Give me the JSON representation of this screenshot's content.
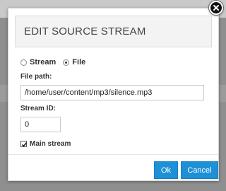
{
  "dialog": {
    "title": "EDIT SOURCE STREAM",
    "close_icon": "close-icon"
  },
  "source_type": {
    "options": [
      "Stream",
      "File"
    ],
    "selected": "File"
  },
  "file_path": {
    "label": "File path:",
    "value": "/home/user/content/mp3/silence.mp3"
  },
  "stream_id": {
    "label": "Stream ID:",
    "value": "0"
  },
  "main_stream": {
    "label": "Main stream",
    "checked": true
  },
  "buttons": {
    "ok_label": "Ok",
    "cancel_label": "Cancel"
  },
  "colors": {
    "accent": "#1e90d6"
  }
}
